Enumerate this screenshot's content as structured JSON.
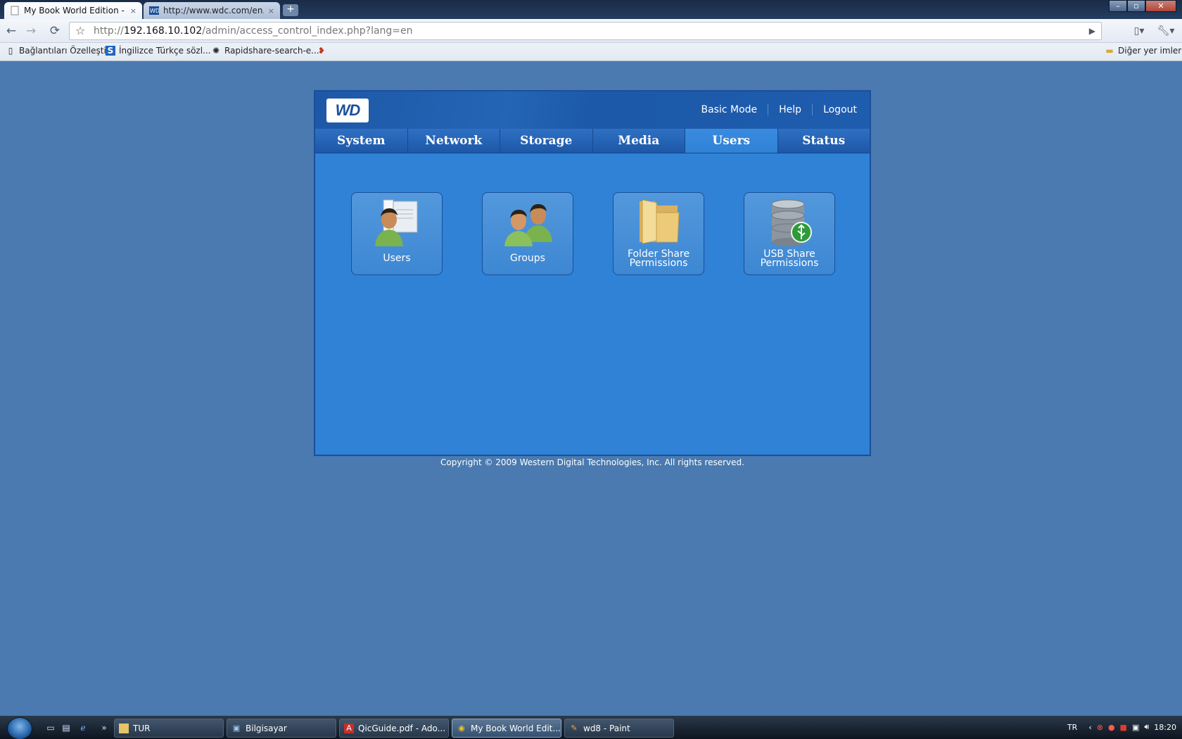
{
  "browser": {
    "tabs": [
      {
        "label": "My Book World Edition - ...",
        "close": "×"
      },
      {
        "label": "http://www.wdc.com/en...",
        "close": "×"
      }
    ],
    "new_tab": "+",
    "address": {
      "scheme": "http://",
      "host": "192.168.10.102",
      "path": "/admin/access_control_index.php?lang=en"
    },
    "bookmarks": [
      {
        "label": "Bağlantıları Özelleştir"
      },
      {
        "label": "İngilizce Türkçe sözl..."
      },
      {
        "label": "Rapidshare-search-e..."
      }
    ],
    "other_bookmarks": "Diğer yer imleri"
  },
  "wd": {
    "logo": "WD",
    "header_links": [
      "Basic Mode",
      "Help",
      "Logout"
    ],
    "nav_tabs": [
      "System",
      "Network",
      "Storage",
      "Media",
      "Users",
      "Status"
    ],
    "active_tab": "Users",
    "tiles": [
      {
        "line1": "Users",
        "line2": ""
      },
      {
        "line1": "Groups",
        "line2": ""
      },
      {
        "line1": "Folder Share",
        "line2": "Permissions"
      },
      {
        "line1": "USB Share",
        "line2": "Permissions"
      }
    ],
    "copyright": "Copyright © 2009 Western Digital Technologies, Inc. All rights reserved."
  },
  "taskbar": {
    "tasks": [
      {
        "label": "TUR"
      },
      {
        "label": "Bilgisayar"
      },
      {
        "label": "QicGuide.pdf - Ado..."
      },
      {
        "label": "My Book World Edit..."
      },
      {
        "label": "wd8 - Paint"
      }
    ],
    "language": "TR",
    "clock": "18:20"
  }
}
